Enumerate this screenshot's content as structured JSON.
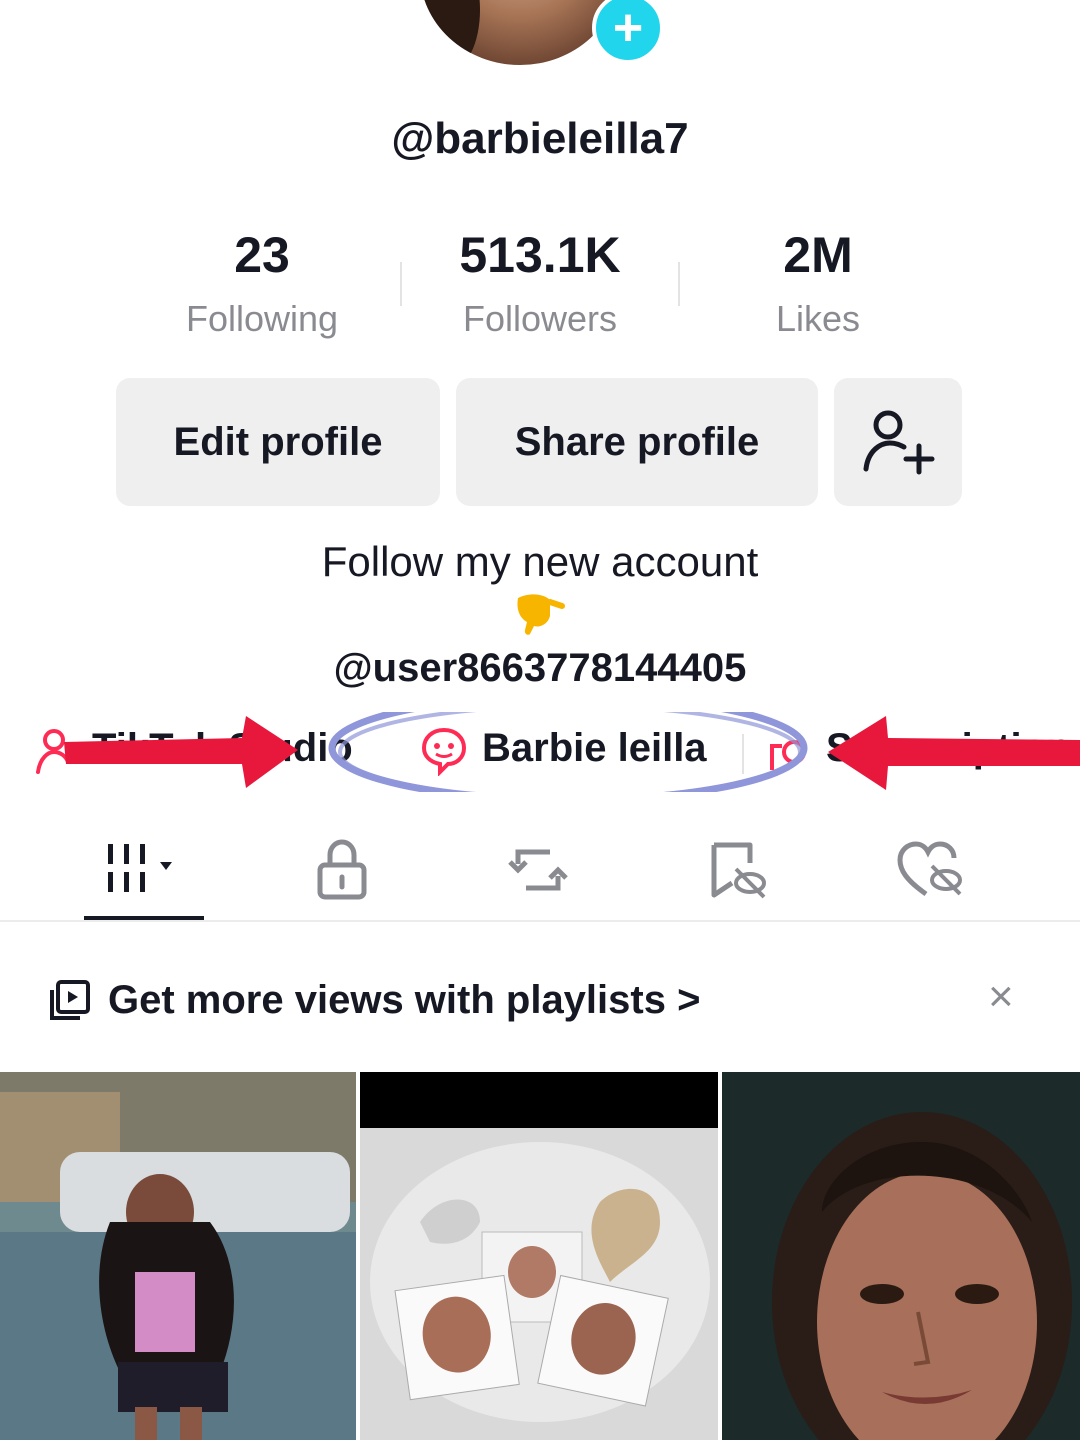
{
  "profile": {
    "username": "@barbieleilla7",
    "add_badge": "+"
  },
  "stats": [
    {
      "value": "23",
      "label": "Following"
    },
    {
      "value": "513.1K",
      "label": "Followers"
    },
    {
      "value": "2M",
      "label": "Likes"
    }
  ],
  "actions": {
    "edit_label": "Edit profile",
    "share_label": "Share profile",
    "add_friend_icon": "person-plus-icon"
  },
  "bio": {
    "line1": "Follow my new account",
    "emoji": "pointing-hand-emoji",
    "line2": "@user8663778144405"
  },
  "links": {
    "left_partial": "TikTok Studio",
    "center": "Barbie leilla",
    "right_partial": "Subscription"
  },
  "annotations": {
    "arrow_color": "#e8173c",
    "circle_color": "#8f96d9"
  },
  "tabs": [
    {
      "icon": "grid-icon",
      "active": true
    },
    {
      "icon": "lock-icon",
      "active": false
    },
    {
      "icon": "repost-icon",
      "active": false
    },
    {
      "icon": "bookmark-hidden-icon",
      "active": false
    },
    {
      "icon": "heart-hidden-icon",
      "active": false
    }
  ],
  "playlist_banner": {
    "text": "Get more views with playlists >",
    "close": "×"
  },
  "colors": {
    "accent_cyan": "#20d5ec",
    "text_primary": "#161823",
    "text_secondary": "#8a8b91",
    "button_bg": "#efefef"
  }
}
